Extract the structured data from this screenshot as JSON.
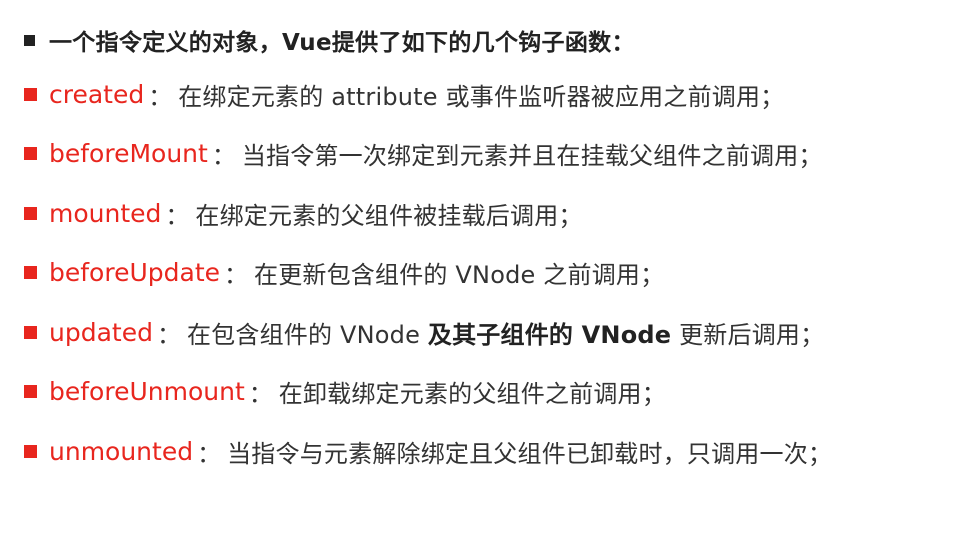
{
  "heading": "一个指令定义的对象，Vue提供了如下的几个钩子函数：",
  "hooks": [
    {
      "name": "created",
      "sep": "：",
      "desc": "在绑定元素的 attribute 或事件监听器被应用之前调用；"
    },
    {
      "name": "beforeMount",
      "sep": "：",
      "desc": "当指令第一次绑定到元素并且在挂载父组件之前调用；"
    },
    {
      "name": "mounted",
      "sep": "：",
      "desc": "在绑定元素的父组件被挂载后调用；"
    },
    {
      "name": "beforeUpdate",
      "sep": "：",
      "desc": "在更新包含组件的 VNode 之前调用；"
    },
    {
      "name": "updated",
      "sep": "：",
      "desc_pre": "在包含组件的 VNode ",
      "desc_bold": "及其子组件的 VNode",
      "desc_post": " 更新后调用；"
    },
    {
      "name": "beforeUnmount",
      "sep": "：",
      "desc": "在卸载绑定元素的父组件之前调用；"
    },
    {
      "name": "unmounted",
      "sep": "：",
      "desc": "当指令与元素解除绑定且父组件已卸载时，只调用一次；"
    }
  ],
  "colors": {
    "hook_name": "#e8261e",
    "bullet_red": "#e8261e",
    "text": "#333333"
  }
}
